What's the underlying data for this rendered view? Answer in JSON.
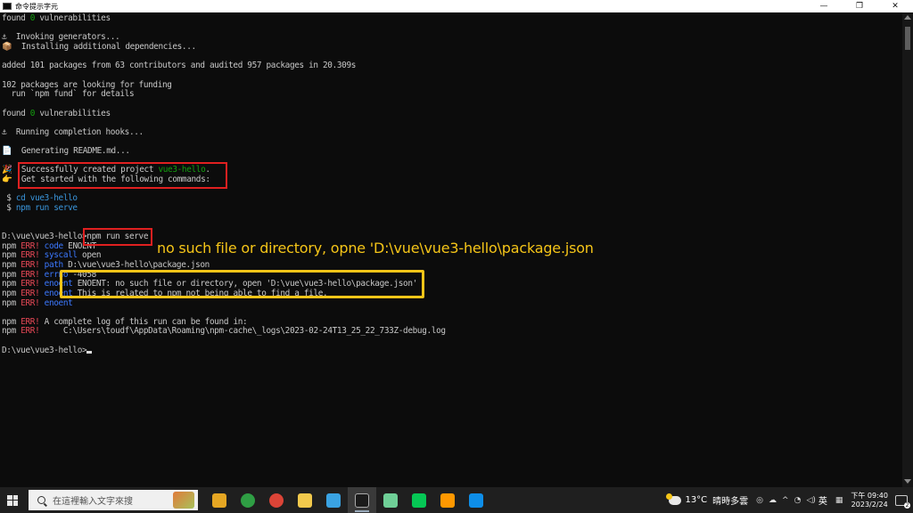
{
  "window": {
    "title": "命令提示字元",
    "minimize": "—",
    "maximize": "❐",
    "close": "✕"
  },
  "console": {
    "lines": [
      [
        {
          "t": "found "
        },
        {
          "t": "0",
          "c": "green"
        },
        {
          "t": " vulnerabilities"
        }
      ],
      [],
      [
        {
          "t": "⚓  Invoking generators..."
        }
      ],
      [
        {
          "t": "📦  Installing additional dependencies..."
        }
      ],
      [],
      [
        {
          "t": "added 101 packages from 63 contributors and audited 957 packages in 20.309s"
        }
      ],
      [],
      [
        {
          "t": "102 packages are looking for funding"
        }
      ],
      [
        {
          "t": "  run `npm fund` for details"
        }
      ],
      [],
      [
        {
          "t": "found "
        },
        {
          "t": "0",
          "c": "green"
        },
        {
          "t": " vulnerabilities"
        }
      ],
      [],
      [
        {
          "t": "⚓  Running completion hooks..."
        }
      ],
      [],
      [
        {
          "t": "📄  Generating README.md..."
        }
      ],
      [],
      [
        {
          "t": "🎉  Successfully created project "
        },
        {
          "t": "vue3-hello",
          "c": "green"
        },
        {
          "t": "."
        }
      ],
      [
        {
          "t": "👉  Get started with the following commands:"
        }
      ],
      [],
      [
        {
          "t": " $ ",
          "c": "gray"
        },
        {
          "t": "cd vue3-hello",
          "c": "cyan"
        }
      ],
      [
        {
          "t": " $ ",
          "c": "gray"
        },
        {
          "t": "npm run serve",
          "c": "cyan"
        }
      ],
      [],
      [],
      [
        {
          "t": "D:\\vue\\vue3-hello>npm run serve"
        }
      ],
      [
        {
          "t": "npm "
        },
        {
          "t": "ERR!",
          "c": "red"
        },
        {
          "t": " "
        },
        {
          "t": "code",
          "c": "blue"
        },
        {
          "t": " ENOENT"
        }
      ],
      [
        {
          "t": "npm "
        },
        {
          "t": "ERR!",
          "c": "red"
        },
        {
          "t": " "
        },
        {
          "t": "syscall",
          "c": "blue"
        },
        {
          "t": " open"
        }
      ],
      [
        {
          "t": "npm "
        },
        {
          "t": "ERR!",
          "c": "red"
        },
        {
          "t": " "
        },
        {
          "t": "path",
          "c": "blue"
        },
        {
          "t": " D:\\vue\\vue3-hello\\package.json"
        }
      ],
      [
        {
          "t": "npm "
        },
        {
          "t": "ERR!",
          "c": "red"
        },
        {
          "t": " "
        },
        {
          "t": "errno",
          "c": "blue"
        },
        {
          "t": " -4058"
        }
      ],
      [
        {
          "t": "npm "
        },
        {
          "t": "ERR!",
          "c": "red"
        },
        {
          "t": " "
        },
        {
          "t": "enoent",
          "c": "blue"
        },
        {
          "t": " ENOENT: no such file or directory, open 'D:\\vue\\vue3-hello\\package.json'"
        }
      ],
      [
        {
          "t": "npm "
        },
        {
          "t": "ERR!",
          "c": "red"
        },
        {
          "t": " "
        },
        {
          "t": "enoent",
          "c": "blue"
        },
        {
          "t": " This is related to npm not being able to find a file."
        }
      ],
      [
        {
          "t": "npm "
        },
        {
          "t": "ERR!",
          "c": "red"
        },
        {
          "t": " "
        },
        {
          "t": "enoent",
          "c": "blue"
        }
      ],
      [],
      [
        {
          "t": "npm "
        },
        {
          "t": "ERR!",
          "c": "red"
        },
        {
          "t": " A complete log of this run can be found in:"
        }
      ],
      [
        {
          "t": "npm "
        },
        {
          "t": "ERR!",
          "c": "red"
        },
        {
          "t": "     C:\\Users\\toudf\\AppData\\Roaming\\npm-cache\\_logs\\2023-02-24T13_25_22_733Z-debug.log"
        }
      ],
      [],
      [
        {
          "t": "D:\\vue\\vue3-hello>"
        },
        {
          "cursor": true
        }
      ]
    ]
  },
  "annotation": {
    "text": "no such file or directory, opne 'D:\\vue\\vue3-hello\\package.json"
  },
  "taskbar": {
    "search_placeholder": "在這裡輸入文字來搜",
    "weather_temp": "13°C",
    "weather_desc": "晴時多雲",
    "ime": "英",
    "time": "下午 09:40",
    "date": "2023/2/24",
    "apps": [
      {
        "name": "taskbar-app-file-manager",
        "color": "#e5a623"
      },
      {
        "name": "taskbar-app-chrome",
        "color": "#2f9e44"
      },
      {
        "name": "taskbar-app-chrome-2",
        "color": "#db4437"
      },
      {
        "name": "taskbar-app-file-explorer",
        "color": "#f2c94c"
      },
      {
        "name": "taskbar-app-edge",
        "color": "#3aa3e3"
      },
      {
        "name": "taskbar-app-command-prompt",
        "color": "#1b1b1b"
      },
      {
        "name": "taskbar-app-notepad",
        "color": "#6fcf97"
      },
      {
        "name": "taskbar-app-line",
        "color": "#06c755"
      },
      {
        "name": "taskbar-app-sublime",
        "color": "#ff9800"
      },
      {
        "name": "taskbar-app-teamviewer",
        "color": "#0e8ee9"
      }
    ]
  }
}
